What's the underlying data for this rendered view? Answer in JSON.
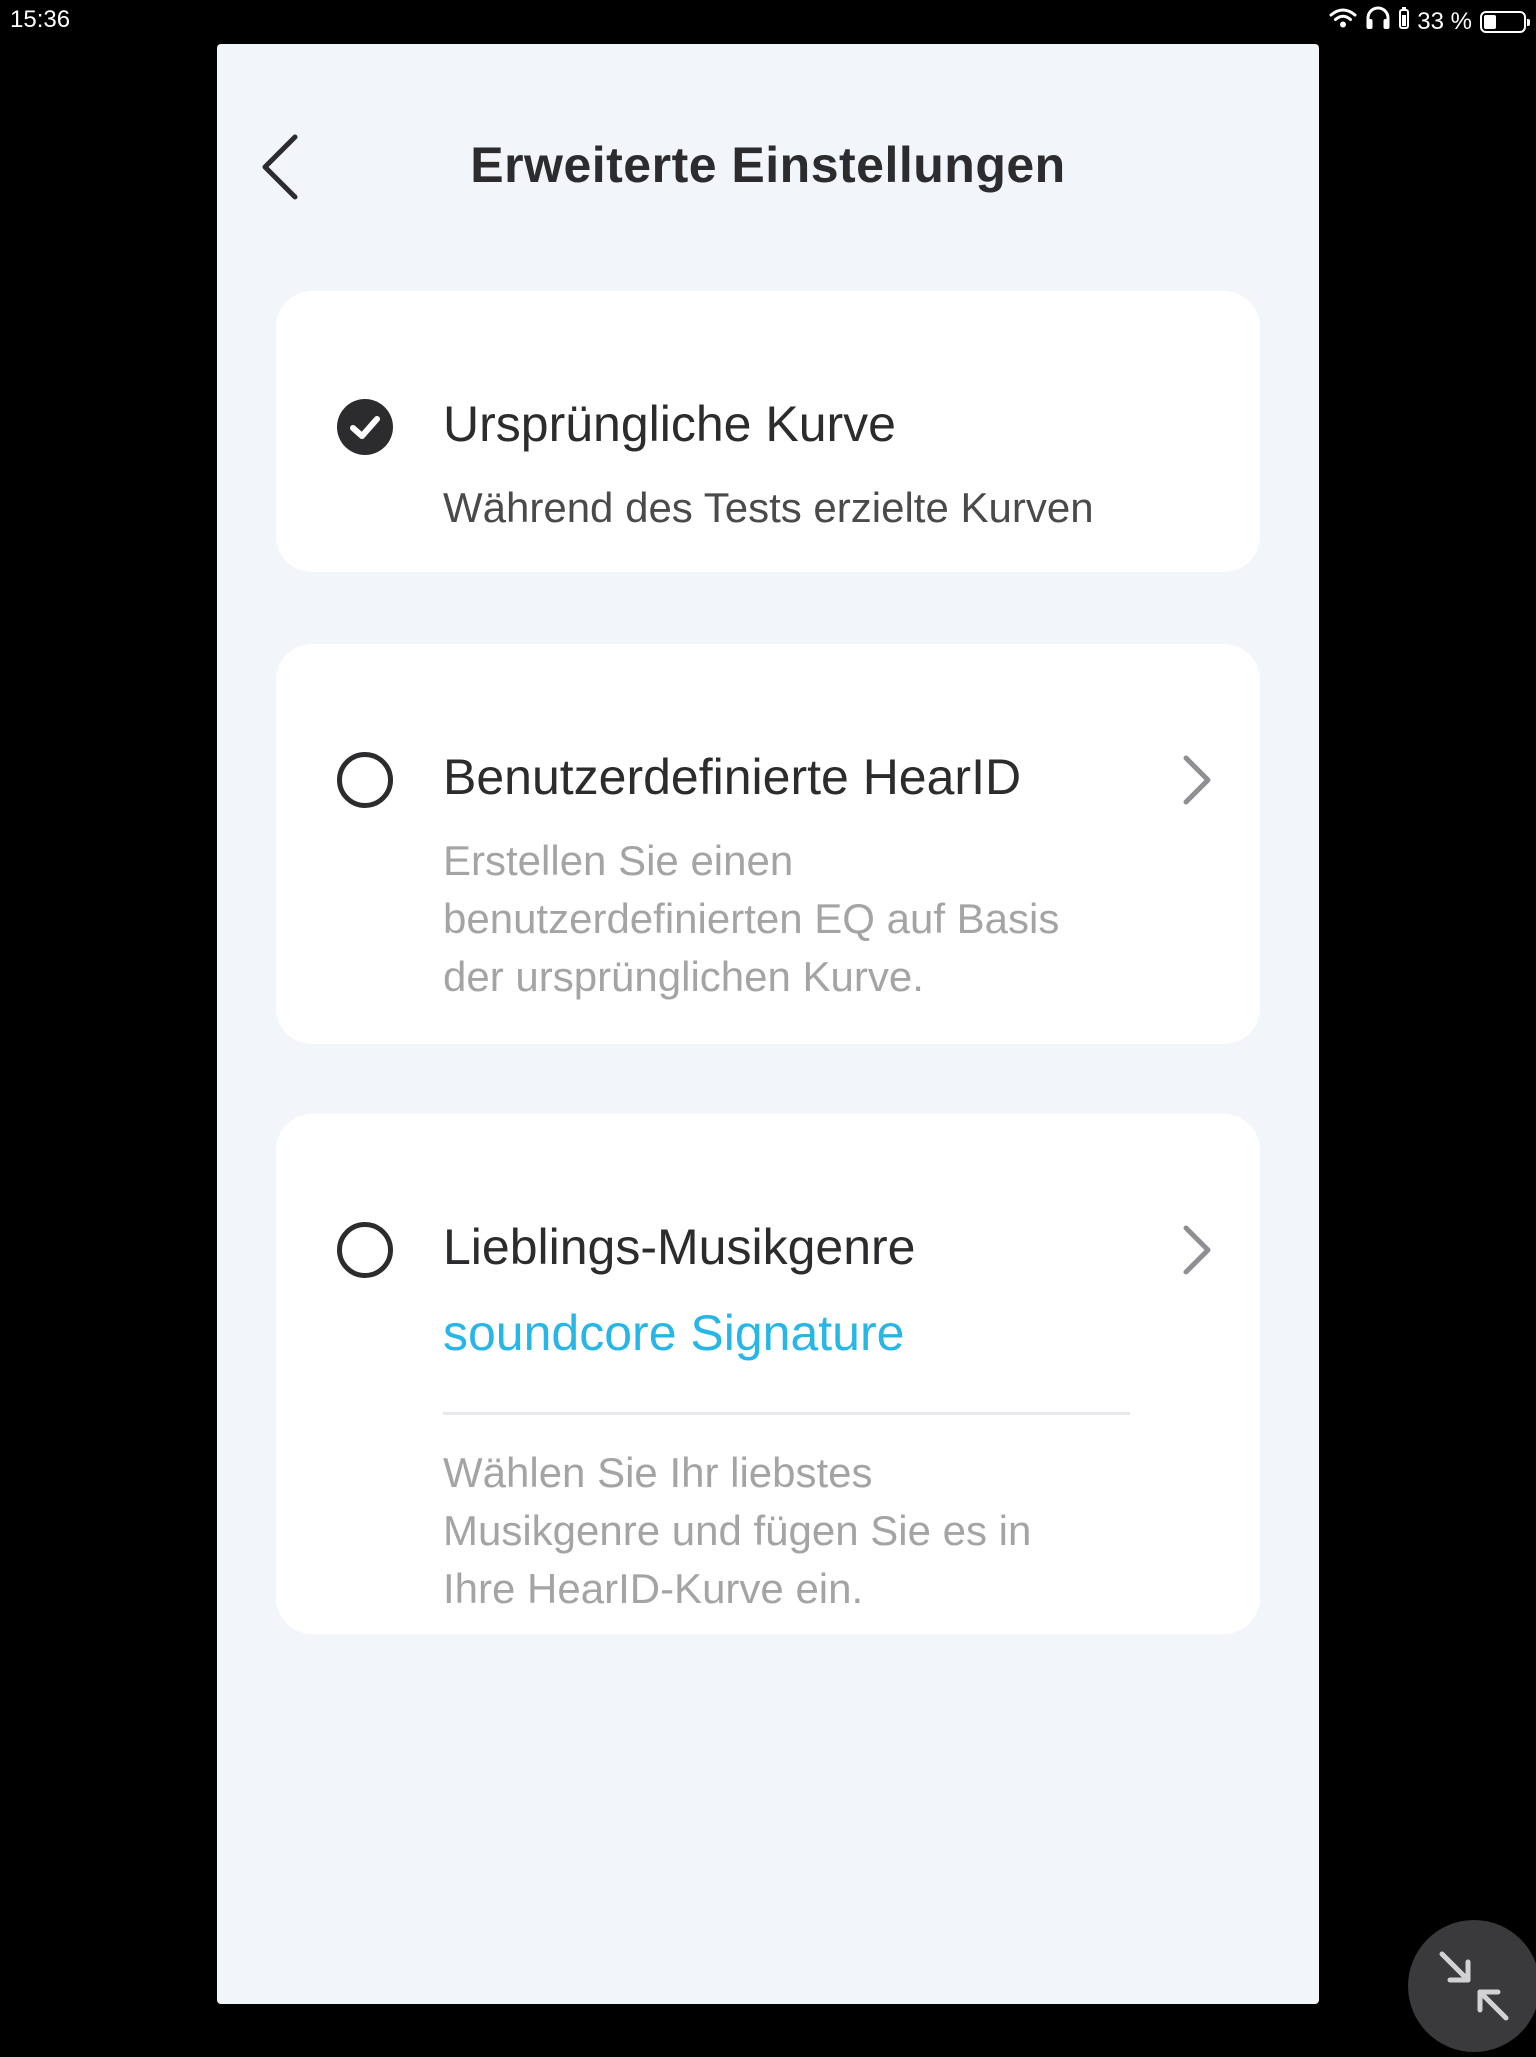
{
  "status_bar": {
    "time": "15:36",
    "battery_text": "33 %",
    "battery_level_percent": 33
  },
  "header": {
    "title": "Erweiterte Einstellungen"
  },
  "options": [
    {
      "title": "Ursprüngliche Kurve",
      "description": "Während des Tests erzielte Kurven",
      "selected": true
    },
    {
      "title": "Benutzerdefinierte HearID",
      "description_lines": [
        "Erstellen Sie einen",
        "benutzerdefinierten EQ auf Basis",
        "der ursprünglichen Kurve."
      ],
      "selected": false
    },
    {
      "title": "Lieblings-Musikgenre",
      "value": "soundcore Signature",
      "description_lines": [
        "Wählen Sie Ihr liebstes",
        "Musikgenre und fügen Sie es in",
        "Ihre HearID-Kurve ein."
      ],
      "selected": false
    }
  ],
  "colors": {
    "accent": "#27b6e5",
    "panel_background": "#f2f5f9",
    "card_background": "#ffffff",
    "text_primary": "#2c2c2e",
    "text_secondary": "#a4a4a7"
  },
  "icons": {
    "back": "chevron-left-icon",
    "forward": "chevron-right-icon",
    "check": "check-circle-icon",
    "minimize": "minimize-arrows-icon"
  }
}
